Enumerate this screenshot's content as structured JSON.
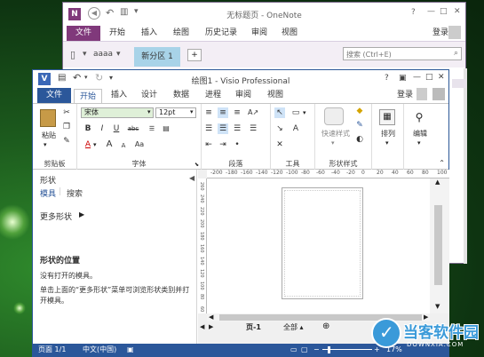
{
  "onenote": {
    "app_badge": "N",
    "title": "无标题页 - OneNote",
    "title_buttons": {
      "help": "?",
      "restore": "▣",
      "minimize": "—",
      "maximize": "□",
      "close": "✕"
    },
    "file_tab": "文件",
    "ribbon_tabs": [
      "开始",
      "插入",
      "绘图",
      "历史记录",
      "审阅",
      "视图"
    ],
    "signin": "登录",
    "notebook": "aaaa",
    "section_tab": "新分区 1",
    "add_section": "+",
    "search_placeholder": "搜索 (Ctrl+E)",
    "search_icon": "⌕"
  },
  "visio": {
    "app_badge": "V",
    "title": "绘图1 - Visio Professional",
    "title_buttons": {
      "help": "?",
      "restore": "▣",
      "minimize": "—",
      "maximize": "□",
      "close": "✕"
    },
    "file_tab": "文件",
    "tabs": [
      "开始",
      "插入",
      "设计",
      "数据",
      "进程",
      "审阅",
      "视图"
    ],
    "active_tab": "开始",
    "signin": "登录",
    "ribbon": {
      "clipboard": {
        "paste": "粘贴",
        "label": "剪贴板"
      },
      "font": {
        "name": "宋体",
        "size": "12pt",
        "bold": "B",
        "italic": "I",
        "underline": "U",
        "strike": "abc",
        "size_grow": "A",
        "size_shrink": "A",
        "font_color": "A",
        "case": "Aa",
        "label": "字体"
      },
      "paragraph": {
        "label": "段落"
      },
      "tools": {
        "label": "工具"
      },
      "shape_styles": {
        "quick_styles": "快速样式",
        "label": "形状样式"
      },
      "arrange": {
        "label": "排列"
      },
      "edit": {
        "label": "编辑"
      }
    },
    "shapes_panel": {
      "title": "形状",
      "tab_stencils": "模具",
      "tab_search": "搜索",
      "more_shapes": "更多形状",
      "location_title": "形状的位置",
      "no_stencils": "没有打开的模具。",
      "hint": "单击上面的“更多形状”菜单可浏览形状类别并打开模具。"
    },
    "ruler_labels": [
      "-200",
      "-180",
      "-160",
      "-140",
      "-120",
      "-100",
      "-80",
      "-60",
      "-40",
      "-20",
      "0",
      "20",
      "40",
      "60",
      "80",
      "100"
    ],
    "vruler_labels": [
      "260",
      "240",
      "220",
      "200",
      "180",
      "160",
      "140",
      "120",
      "100",
      "80",
      "60"
    ],
    "page_tab": "页-1",
    "all_pages": "全部 ▴",
    "add_page": "⊕",
    "status": {
      "page": "页面 1/1",
      "language": "中文(中国)",
      "zoom": "17%"
    }
  },
  "watermark": {
    "brand": "当客软件园",
    "subtitle": "DOWNXIA.COM"
  }
}
